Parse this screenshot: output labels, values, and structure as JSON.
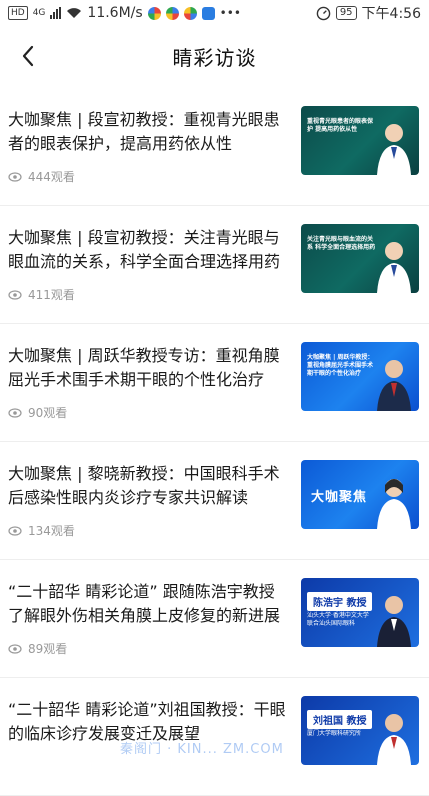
{
  "status_bar": {
    "hd": "HD",
    "network": "4G",
    "speed": "11.6M/s",
    "battery": "95",
    "time": "下午4:56"
  },
  "header": {
    "title": "睛彩访谈",
    "back_icon": "chevron-left-icon"
  },
  "articles": [
    {
      "title": "大咖聚焦 | 段宣初教授：重视青光眼患者的眼表保护，提高用药依从性",
      "views": "444观看",
      "thumb_text": "重视青光眼患者的眼表保护 提高用药依从性",
      "thumb_style": "green"
    },
    {
      "title": "大咖聚焦 | 段宣初教授：关注青光眼与眼血流的关系，科学全面合理选择用药",
      "views": "411观看",
      "thumb_text": "关注青光眼与眼血流的关系 科学全面合理选择用药",
      "thumb_style": "green"
    },
    {
      "title": "大咖聚焦 | 周跃华教授专访：重视角膜屈光手术围手术期干眼的个性化治疗",
      "views": "90观看",
      "thumb_text": "大咖聚焦 | 周跃华教授：重视角膜屈光手术围手术期干眼的个性化治疗",
      "thumb_style": "blue"
    },
    {
      "title": "大咖聚焦 | 黎晓新教授：中国眼科手术后感染性眼内炎诊疗专家共识解读",
      "views": "134观看",
      "thumb_text": "大咖聚焦",
      "thumb_style": "blue"
    },
    {
      "title": "“二十韶华 睛彩论道” 跟随陈浩宇教授了解眼外伤相关角膜上皮修复的新进展",
      "views": "89观看",
      "thumb_text": "陈浩宇 教授",
      "thumb_sub": "汕头大学·香港中文大学联合汕头国际眼科",
      "thumb_style": "navy"
    },
    {
      "title": "“二十韶华 睛彩论道”刘祖国教授：干眼的临床诊疗发展变迁及展望",
      "views": "",
      "thumb_text": "刘祖国 教授",
      "thumb_sub": "厦门大学眼科研究所",
      "thumb_style": "navy"
    }
  ],
  "watermark": "秦阁门 · KIN... ZM.COM",
  "icons": {
    "eye": "eye-icon"
  }
}
